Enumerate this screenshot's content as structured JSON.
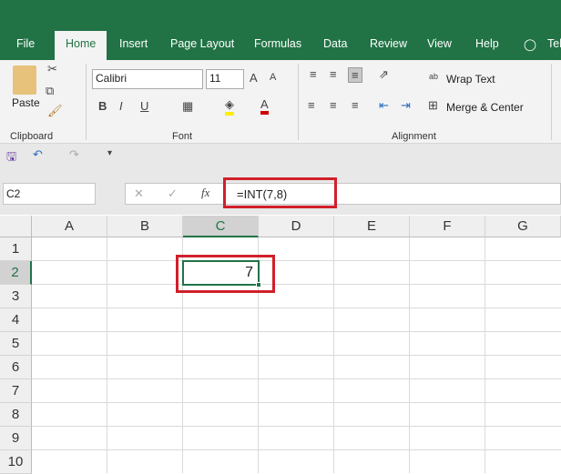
{
  "tabs": [
    "File",
    "Home",
    "Insert",
    "Page Layout",
    "Formulas",
    "Data",
    "Review",
    "View",
    "Help",
    "Tell me"
  ],
  "ribbon": {
    "clipboard": {
      "paste": "Paste",
      "label": "Clipboard"
    },
    "font": {
      "name": "Calibri",
      "size": "11",
      "bold": "B",
      "italic": "I",
      "underline": "U",
      "label": "Font"
    },
    "alignment": {
      "wrap": "Wrap Text",
      "merge": "Merge & Center",
      "label": "Alignment"
    }
  },
  "formula_bar": {
    "name_box": "C2",
    "fx": "fx",
    "formula": "=INT(7,8)"
  },
  "columns": [
    "A",
    "B",
    "C",
    "D",
    "E",
    "F",
    "G"
  ],
  "rows": [
    "1",
    "2",
    "3",
    "4",
    "5",
    "6",
    "7",
    "8",
    "9",
    "10"
  ],
  "cells": {
    "C2": "7"
  },
  "colors": {
    "brand": "#217346",
    "highlight": "#d0202a"
  }
}
